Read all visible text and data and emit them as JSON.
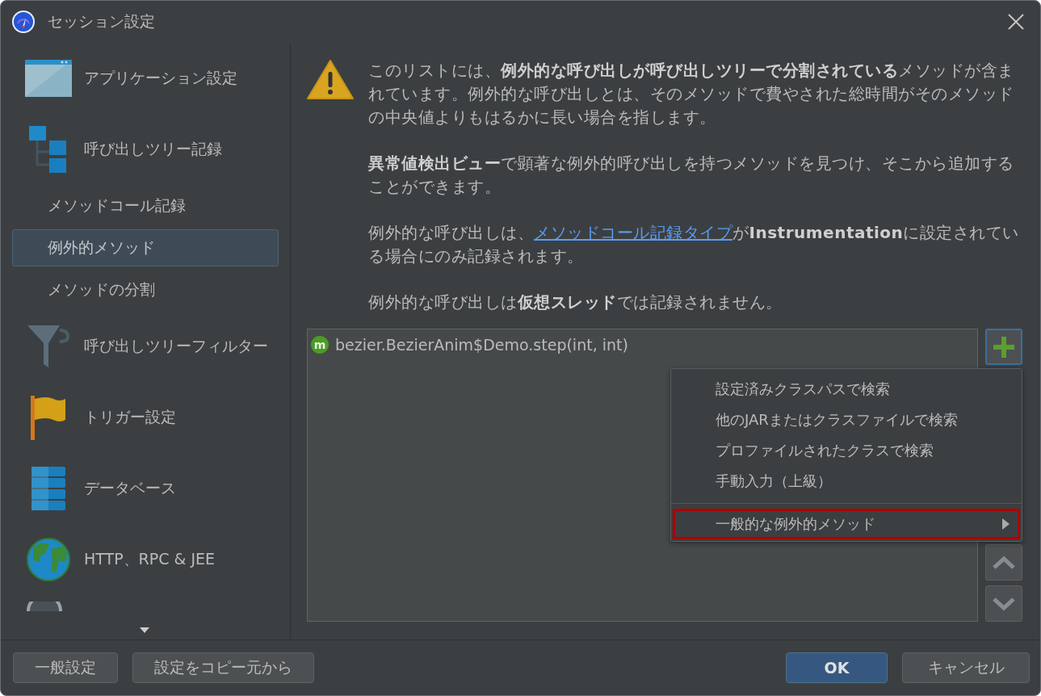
{
  "window": {
    "title": "セッション設定"
  },
  "sidebar": {
    "items": [
      {
        "kind": "large",
        "label": "アプリケーション設定",
        "selected": false
      },
      {
        "kind": "large",
        "label": "呼び出しツリー記録",
        "selected": false
      },
      {
        "kind": "sub",
        "label": "メソッドコール記録",
        "selected": false
      },
      {
        "kind": "sub",
        "label": "例外的メソッド",
        "selected": true
      },
      {
        "kind": "sub",
        "label": "メソッドの分割",
        "selected": false
      },
      {
        "kind": "large",
        "label": "呼び出しツリーフィルター",
        "selected": false
      },
      {
        "kind": "large",
        "label": "トリガー設定",
        "selected": false
      },
      {
        "kind": "large",
        "label": "データベース",
        "selected": false
      },
      {
        "kind": "large",
        "label": "HTTP、RPC & JEE",
        "selected": false
      },
      {
        "kind": "cut"
      }
    ]
  },
  "info": {
    "paragraphs": [
      {
        "parts": [
          {
            "kind": "text",
            "text": "このリストには、**例外的な呼び出しが呼び出しツリーで分割されている**メソッドが含まれています。例外的な呼び出しとは、そのメソッドで費やされた総時間がそのメソッドの中央値よりもはるかに長い場合を指します。"
          }
        ]
      },
      {
        "parts": [
          {
            "kind": "text",
            "text": "**異常値検出ビュー**で顕著な例外的呼び出しを持つメソッドを見つけ、そこから追加することができます。"
          }
        ]
      },
      {
        "parts": [
          {
            "kind": "text",
            "text": "例外的な呼び出しは、"
          },
          {
            "kind": "link",
            "text": "メソッドコール記録タイプ"
          },
          {
            "kind": "text",
            "text": "が**Instrumentation**に設定されている場合にのみ記録されます。"
          }
        ]
      },
      {
        "parts": [
          {
            "kind": "text",
            "text": "例外的な呼び出しは**仮想スレッド**では記録されません。"
          }
        ]
      }
    ]
  },
  "methods": [
    {
      "badge": "m",
      "name": "bezier.BezierAnim$Demo.step(int, int)"
    }
  ],
  "add_menu": {
    "items": [
      {
        "kind": "action",
        "label": "設定済みクラスパスで検索",
        "highlighted": false
      },
      {
        "kind": "action",
        "label": "他のJARまたはクラスファイルで検索",
        "highlighted": false
      },
      {
        "kind": "action",
        "label": "プロファイルされたクラスで検索",
        "highlighted": false
      },
      {
        "kind": "action",
        "label": "手動入力（上級）",
        "highlighted": false
      },
      {
        "kind": "submenu",
        "label": "一般的な例外的メソッド",
        "highlighted": true
      }
    ]
  },
  "footer": {
    "left_buttons": [
      "一般設定",
      "設定をコピー元から"
    ],
    "ok": "OK",
    "cancel": "キャンセル"
  }
}
